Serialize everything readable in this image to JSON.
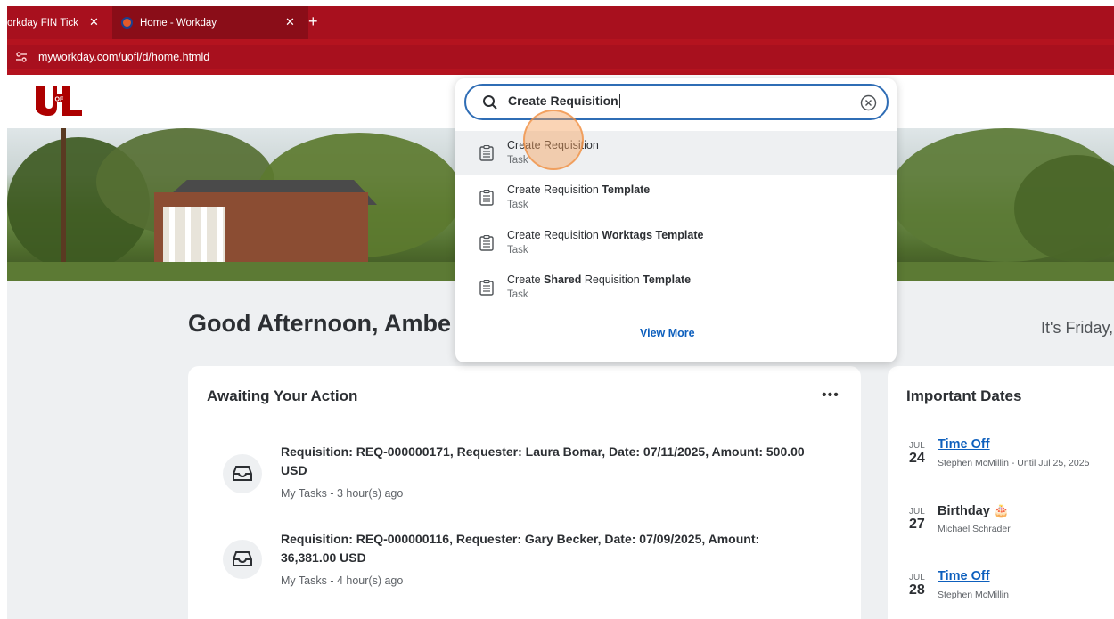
{
  "browser": {
    "tabs": [
      {
        "title": "orkday FIN Ticket",
        "close": "✕"
      },
      {
        "title": "Home - Workday",
        "close": "✕"
      }
    ],
    "new_tab": "+",
    "url": "myworkday.com/uofl/d/home.htmld"
  },
  "header": {
    "logo_text": "UofL",
    "logo_color": "#ad0000"
  },
  "greeting": "Good Afternoon, Ambe",
  "date_text": "It's Friday,",
  "search": {
    "query": "Create Requisition",
    "results": [
      {
        "parts": [
          {
            "t": "Create Requisition",
            "b": false
          }
        ],
        "type": "Task"
      },
      {
        "parts": [
          {
            "t": "Create Requisition ",
            "b": false
          },
          {
            "t": "Template",
            "b": true
          }
        ],
        "type": "Task"
      },
      {
        "parts": [
          {
            "t": "Create Requisition ",
            "b": false
          },
          {
            "t": "Worktags Template",
            "b": true
          }
        ],
        "type": "Task"
      },
      {
        "parts": [
          {
            "t": "Create ",
            "b": false
          },
          {
            "t": "Shared",
            "b": true
          },
          {
            "t": " Requisition ",
            "b": false
          },
          {
            "t": "Template",
            "b": true
          }
        ],
        "type": "Task"
      }
    ],
    "view_more": "View More"
  },
  "awaiting": {
    "title": "Awaiting Your Action",
    "more": "•••",
    "items": [
      {
        "line1": "Requisition: REQ-000000171, Requester: Laura Bomar, Date: 07/11/2025, Amount: 500.00",
        "line2": "USD",
        "meta": "My Tasks - 3 hour(s) ago"
      },
      {
        "line1": "Requisition: REQ-000000116, Requester: Gary Becker, Date: 07/09/2025, Amount:",
        "line2": "36,381.00 USD",
        "meta": "My Tasks - 4 hour(s) ago"
      }
    ]
  },
  "important": {
    "title": "Important Dates",
    "items": [
      {
        "month": "JUL",
        "day": "24",
        "event": "Time Off",
        "link": true,
        "sub": "Stephen McMillin - Until Jul 25, 2025"
      },
      {
        "month": "JUL",
        "day": "27",
        "event": "Birthday 🎂",
        "link": false,
        "sub": "Michael Schrader"
      },
      {
        "month": "JUL",
        "day": "28",
        "event": "Time Off",
        "link": true,
        "sub": "Stephen McMillin"
      }
    ]
  }
}
